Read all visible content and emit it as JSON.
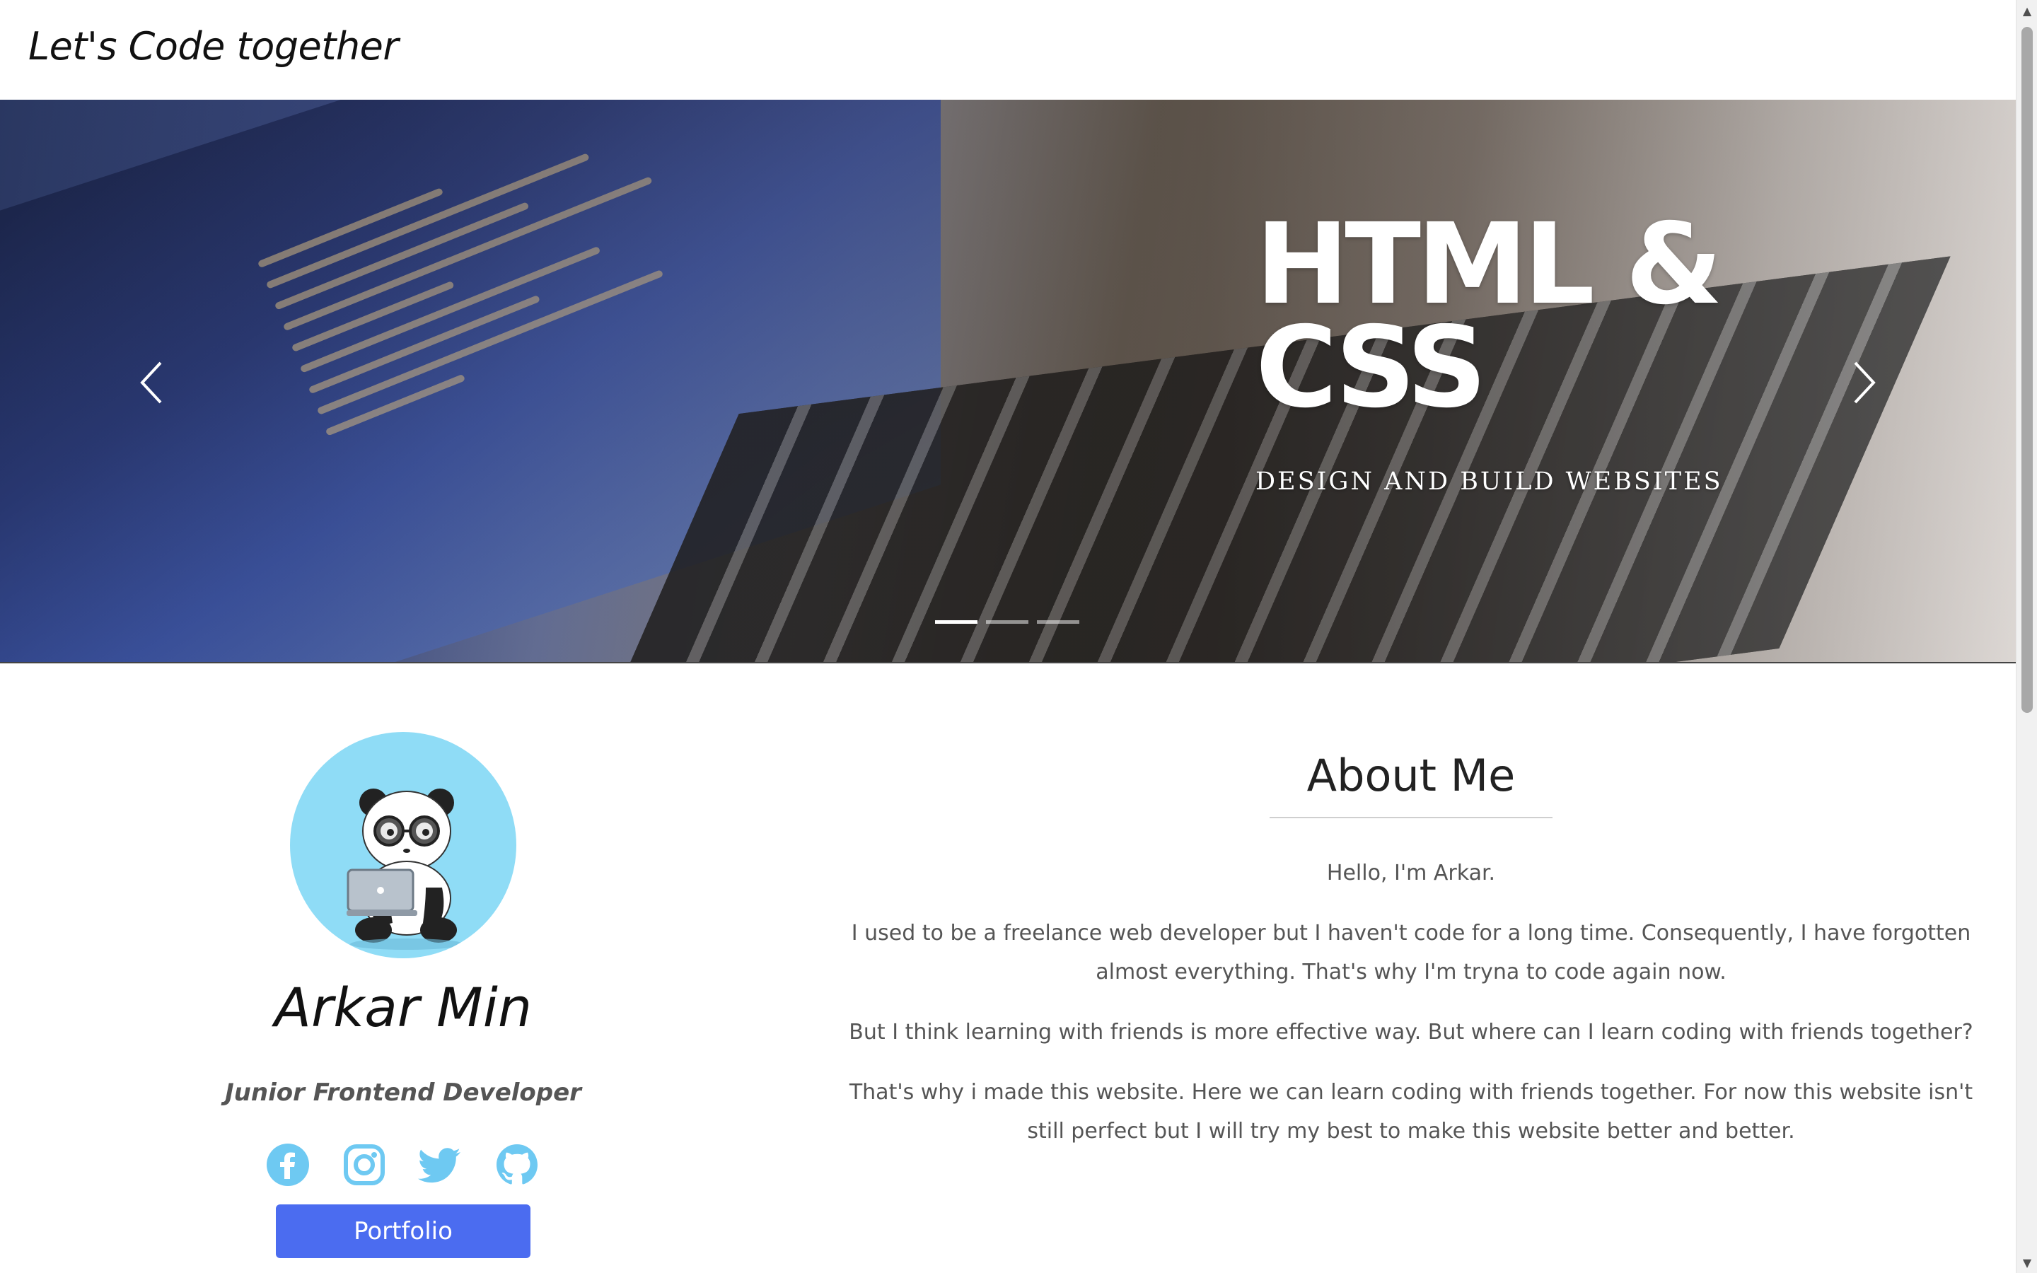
{
  "navbar": {
    "brand": "Let's Code together"
  },
  "hero": {
    "title": "HTML & CSS",
    "subtitle": "DESIGN AND BUILD WEBSITES",
    "slides": 3,
    "active_slide": 1
  },
  "profile": {
    "name": "Arkar Min",
    "role": "Junior Frontend Developer",
    "socials": [
      "facebook-icon",
      "instagram-icon",
      "twitter-icon",
      "github-icon"
    ],
    "portfolio_label": "Portfolio",
    "social_color": "#6ec9f2",
    "button_color": "#4b6cf0"
  },
  "about": {
    "title": "About Me",
    "paragraphs": [
      "Hello, I'm Arkar.",
      "I used to be a freelance web developer but I haven't code for a long time. Consequently, I have forgotten almost everything. That's why I'm tryna to code again now.",
      "But I think learning with friends is more effective way. But where can I learn coding with friends together?",
      "That's why i made this website. Here we can learn coding with friends together. For now this website isn't still perfect but I will try my best to make this website better and better."
    ]
  }
}
